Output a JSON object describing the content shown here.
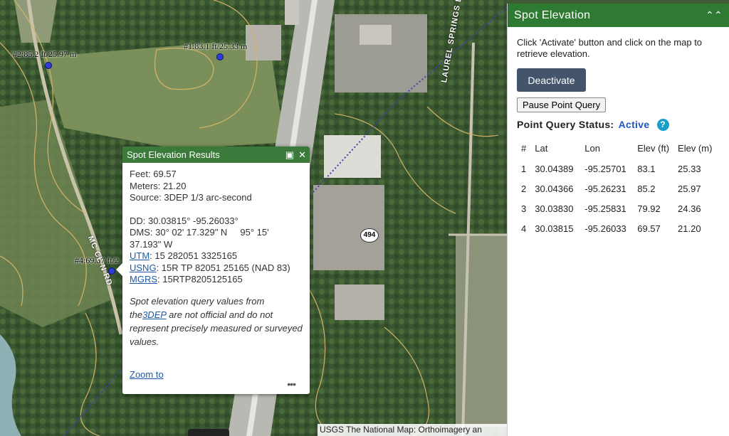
{
  "map": {
    "markers": [
      {
        "id": "1",
        "label": "#1:83.1 ft/25.33 m"
      },
      {
        "id": "2",
        "label": "#2:85.2 ft/25.97 m"
      },
      {
        "id": "4",
        "label": "#4:69.57 ft/2"
      }
    ],
    "route_shield": "494",
    "road_labels": {
      "laurel": "LAUREL SPRINGS LN",
      "mcclellan": "MC CL    N RD"
    },
    "attribution": "USGS The National Map: Orthoimagery an"
  },
  "popup": {
    "title": "Spot Elevation Results",
    "feet": "Feet: 69.57",
    "meters": "Meters: 21.20",
    "source": "Source: 3DEP 1/3 arc-second",
    "dd": "DD: 30.03815° -95.26033°",
    "dms_line1": "DMS: 30° 02' 17.329\" N     95° 15'",
    "dms_line2": "37.193\" W",
    "utm_link": "UTM",
    "utm_value": ": 15 282051 3325165",
    "usng_link": "USNG",
    "usng_value": ": 15R TP 82051 25165 (NAD 83)",
    "mgrs_link": "MGRS",
    "mgrs_value": ": 15RTP8205125165",
    "disclaimer_1": "Spot elevation query values from the",
    "disclaimer_link": "3DEP",
    "disclaimer_2": " are not official and do not represent precisely measured or surveyed values.",
    "zoom_to": "Zoom to"
  },
  "panel": {
    "title": "Spot Elevation",
    "instructions": "Click 'Activate' button and click on the map to retrieve elevation.",
    "deactivate_label": "Deactivate",
    "pause_label": "Pause Point Query",
    "status_label": "Point Query Status:",
    "status_value": "Active",
    "table_headers": [
      "#",
      "Lat",
      "Lon",
      "Elev (ft)",
      "Elev (m)"
    ],
    "table_rows": [
      [
        "1",
        "30.04389",
        "-95.25701",
        "83.1",
        "25.33"
      ],
      [
        "2",
        "30.04366",
        "-95.26231",
        "85.2",
        "25.97"
      ],
      [
        "3",
        "30.03830",
        "-95.25831",
        "79.92",
        "24.36"
      ],
      [
        "4",
        "30.03815",
        "-95.26033",
        "69.57",
        "21.20"
      ]
    ]
  },
  "colors": {
    "header_green": "#2f7a33",
    "status_active": "#1f56c4",
    "marker_blue": "#2f3fd6"
  }
}
